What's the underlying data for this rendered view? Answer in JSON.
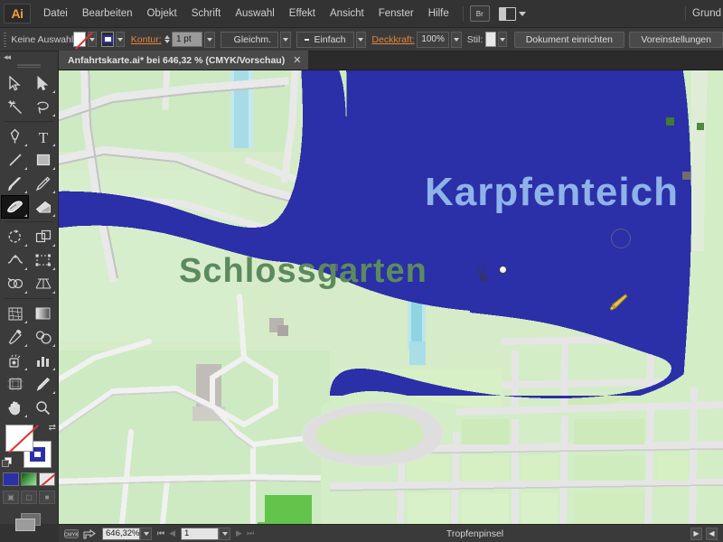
{
  "app": {
    "name": "Adobe Illustrator",
    "logo_text": "Ai",
    "workspace": "Grund"
  },
  "menubar": {
    "items": [
      {
        "label": "Datei"
      },
      {
        "label": "Bearbeiten"
      },
      {
        "label": "Objekt"
      },
      {
        "label": "Schrift"
      },
      {
        "label": "Auswahl"
      },
      {
        "label": "Effekt"
      },
      {
        "label": "Ansicht"
      },
      {
        "label": "Fenster"
      },
      {
        "label": "Hilfe"
      }
    ],
    "bridge_label": "Br",
    "arrange_icon": "arrange-documents-icon"
  },
  "controlbar": {
    "selection_label": "Keine Auswahl",
    "fill_swatch": "none",
    "stroke_swatch": "blue-square",
    "stroke_label": "Kontur:",
    "stroke_weight": "1 pt",
    "profile_label": "Gleichm.",
    "brush_label": "Einfach",
    "opacity_label": "Deckkraft:",
    "opacity_value": "100%",
    "style_label": "Stil:",
    "document_setup_label": "Dokument einrichten",
    "preferences_label": "Voreinstellungen"
  },
  "tab": {
    "title": "Anfahrtskarte.ai* bei 646,32 %  (CMYK/Vorschau)",
    "close_glyph": "✕"
  },
  "toolbar": {
    "tools": [
      {
        "name": "selection-tool",
        "selected": false
      },
      {
        "name": "direct-selection-tool",
        "selected": false
      },
      {
        "name": "magic-wand-tool",
        "selected": false
      },
      {
        "name": "lasso-tool",
        "selected": false
      },
      {
        "name": "pen-tool",
        "selected": false
      },
      {
        "name": "type-tool",
        "selected": false
      },
      {
        "name": "line-segment-tool",
        "selected": false
      },
      {
        "name": "rectangle-tool",
        "selected": false
      },
      {
        "name": "paintbrush-tool",
        "selected": false
      },
      {
        "name": "pencil-tool",
        "selected": false
      },
      {
        "name": "blob-brush-tool",
        "selected": true
      },
      {
        "name": "eraser-tool",
        "selected": false
      },
      {
        "name": "rotate-tool",
        "selected": false
      },
      {
        "name": "scale-tool",
        "selected": false
      },
      {
        "name": "width-tool",
        "selected": false
      },
      {
        "name": "free-transform-tool",
        "selected": false
      },
      {
        "name": "shape-builder-tool",
        "selected": false
      },
      {
        "name": "perspective-grid-tool",
        "selected": false
      },
      {
        "name": "mesh-tool",
        "selected": false
      },
      {
        "name": "gradient-tool",
        "selected": false
      },
      {
        "name": "eyedropper-tool",
        "selected": false
      },
      {
        "name": "blend-tool",
        "selected": false
      },
      {
        "name": "symbol-sprayer-tool",
        "selected": false
      },
      {
        "name": "column-graph-tool",
        "selected": false
      },
      {
        "name": "artboard-tool",
        "selected": false
      },
      {
        "name": "slice-tool",
        "selected": false
      },
      {
        "name": "hand-tool",
        "selected": false
      },
      {
        "name": "zoom-tool",
        "selected": false
      }
    ],
    "fill_mode": "none",
    "stroke_color": "#2b2fa8",
    "swatch_modes": [
      "color",
      "gradient",
      "none"
    ],
    "screen_modes": [
      "normal-screen-mode",
      "full-screen-menubar",
      "full-screen"
    ]
  },
  "canvas": {
    "labels": [
      {
        "name": "map-label-karpfenteich",
        "text": "Karpfenteich",
        "color": "#8fb3e8"
      },
      {
        "name": "map-label-schlossgarten",
        "text": "Schlossgarten",
        "color": "#5d8a5d"
      }
    ],
    "colors": {
      "water": "#2b2fa8",
      "park_light": "#cdeac2",
      "park_mid": "#d9edd0",
      "park_dark": "#63c44c",
      "road": "#e9e9e9",
      "road_shadow": "#b9b9b9",
      "background": "#dfe8d8",
      "stream": "#8fd4e0"
    },
    "active_tool_cursor": "blob-brush-circle-cursor"
  },
  "statusbar": {
    "zoom_value": "646,32%",
    "page_value": "1",
    "status_text": "Tropfenpinsel",
    "nav_first": "⏮",
    "nav_prev": "◀",
    "nav_next": "▶",
    "nav_last": "⏭"
  }
}
